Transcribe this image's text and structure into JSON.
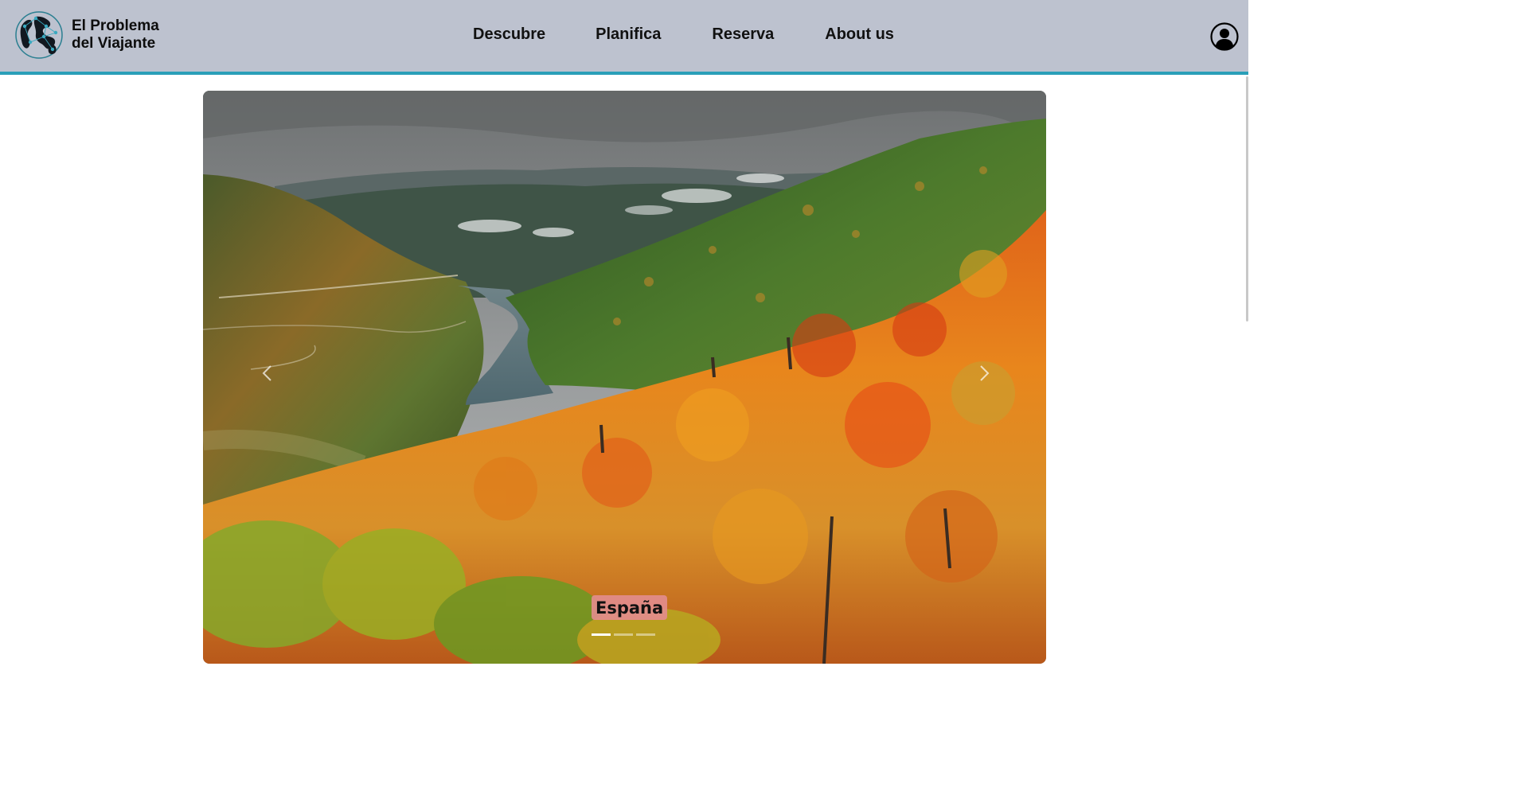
{
  "brand": {
    "name_line1": "El Problema",
    "name_line2": "del Viajante",
    "logo_icon": "globe-network-icon"
  },
  "nav": {
    "links": [
      {
        "label": "Descubre"
      },
      {
        "label": "Planifica"
      },
      {
        "label": "Reserva"
      },
      {
        "label": "About us"
      }
    ],
    "user_icon": "user-account-icon"
  },
  "carousel": {
    "caption": "España",
    "active_slide": 1,
    "slide_count": 3,
    "prev_icon": "chevron-left-icon",
    "next_icon": "chevron-right-icon"
  },
  "colors": {
    "navbar_bg": "#bdc2cf",
    "navbar_accent": "#2a9fb8",
    "caption_bg": "#e28c8c"
  }
}
